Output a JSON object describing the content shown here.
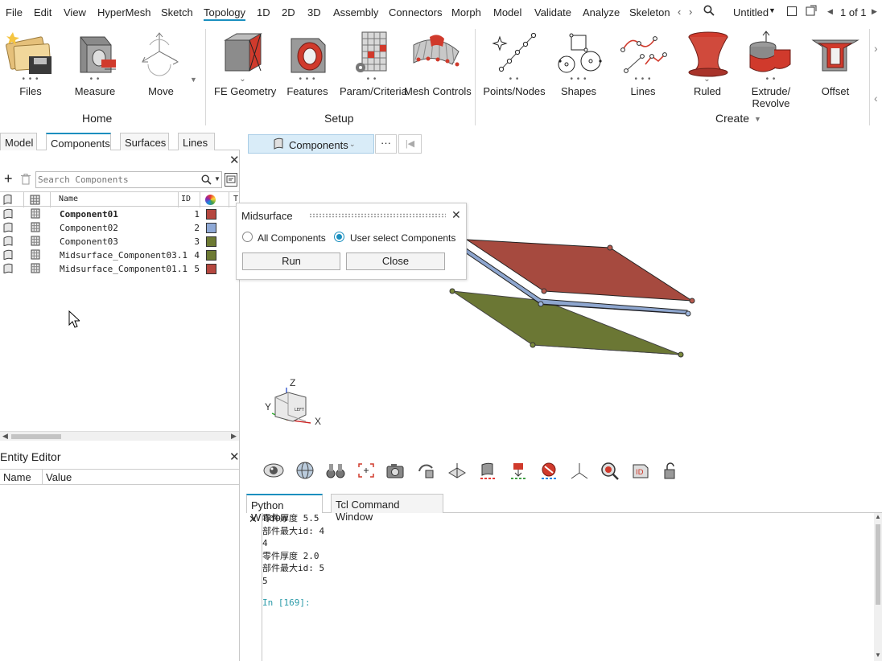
{
  "menubar": {
    "items": [
      "File",
      "Edit",
      "View",
      "HyperMesh",
      "Sketch",
      "Topology",
      "1D",
      "2D",
      "3D",
      "Assembly",
      "Connectors",
      "Morph",
      "Model",
      "Validate",
      "Analyze",
      "Skeleton"
    ],
    "active": "Topology",
    "doc_title": "Untitled",
    "page_counter": "1 of 1"
  },
  "ribbon": {
    "home": {
      "label": "Home",
      "tools": [
        "Files",
        "Measure",
        "Move"
      ]
    },
    "setup": {
      "label": "Setup",
      "tools": [
        "FE Geometry",
        "Features",
        "Param/Criteria",
        "Mesh Controls"
      ]
    },
    "create": {
      "label": "Create",
      "tools": [
        "Points/Nodes",
        "Shapes",
        "Lines",
        "Ruled",
        "Extrude/",
        "Revolve",
        "Offset"
      ]
    }
  },
  "left_tabs": [
    "Model",
    "Components",
    "Surfaces",
    "Lines"
  ],
  "search": {
    "placeholder": "Search Components"
  },
  "table": {
    "headers": {
      "name": "Name",
      "id": "ID",
      "extra": "T"
    },
    "rows": [
      {
        "name": "Component01",
        "id": "1",
        "color": "#b5473f",
        "bold": true
      },
      {
        "name": "Component02",
        "id": "2",
        "color": "#8fa9d6",
        "bold": false
      },
      {
        "name": "Component03",
        "id": "3",
        "color": "#6d7a33",
        "bold": false
      },
      {
        "name": "Midsurface_Component03.1",
        "id": "4",
        "color": "#6d7a33",
        "bold": false
      },
      {
        "name": "Midsurface_Component01.1",
        "id": "5",
        "color": "#b5473f",
        "bold": false
      }
    ]
  },
  "viewport_toolbar": {
    "selector_label": "Components",
    "more": "···"
  },
  "dialog": {
    "title": "Midsurface",
    "option_all": "All Components",
    "option_user": "User select Components",
    "selected": "user",
    "run_label": "Run",
    "close_label": "Close"
  },
  "axes": {
    "z": "Z",
    "y": "Y",
    "x": "X"
  },
  "entity_editor": {
    "title": "Entity Editor",
    "col_name": "Name",
    "col_value": "Value"
  },
  "bottom_tabs": [
    "Python Window",
    "Tcl Command Window"
  ],
  "console": {
    "lines": [
      "零件厚度 5.5",
      "部件最大id: 4",
      "4",
      "零件厚度 2.0",
      "部件最大id: 5",
      "5",
      ""
    ],
    "prompt": "In [169]:"
  },
  "colors": {
    "accent": "#1a8fbf",
    "red_part": "#a64a3f",
    "blue_part": "#8ea6cf",
    "green_part": "#6b7734"
  }
}
